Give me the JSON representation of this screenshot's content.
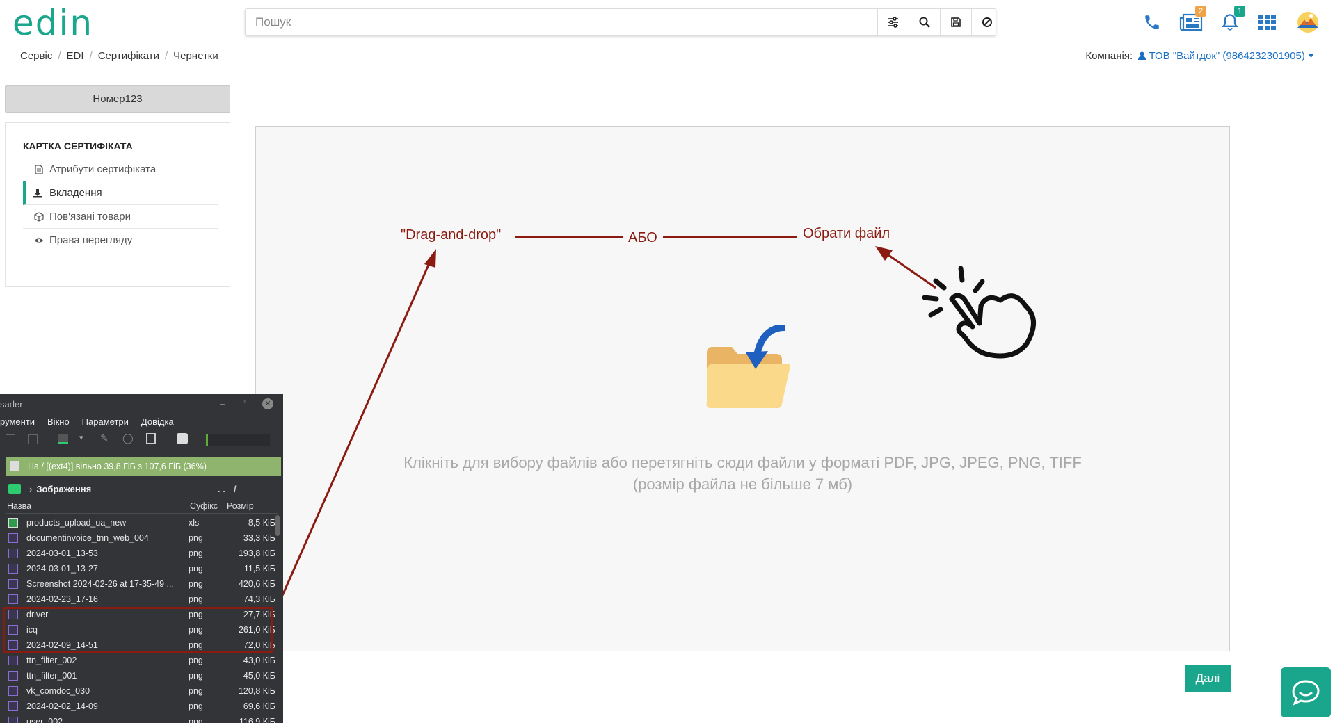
{
  "header": {
    "logo": "edin",
    "search_placeholder": "Пошук",
    "icons": [
      "filter-settings-icon",
      "search-icon",
      "save-icon",
      "cancel-icon",
      "phone-icon",
      "news-icon",
      "bell-icon",
      "apps-grid-icon",
      "user-avatar"
    ],
    "news_badge": "2",
    "bell_badge": "1"
  },
  "breadcrumbs": [
    "Сервіс",
    "EDI",
    "Сертифікати",
    "Чернетки"
  ],
  "company": {
    "label": "Компанія:",
    "value": "ТОВ \"Вайтдок\" (9864232301905)"
  },
  "sidebar": {
    "number_button": "Номер123",
    "card_title": "КАРТКА СЕРТИФІКАТА",
    "items": [
      {
        "label": "Атрибути сертифіката",
        "icon": "document-icon"
      },
      {
        "label": "Вкладення",
        "icon": "download-icon"
      },
      {
        "label": "Пов'язані товари",
        "icon": "box-icon"
      },
      {
        "label": "Права перегляду",
        "icon": "eye-icon"
      }
    ]
  },
  "dropzone": {
    "hint_line1": "Клікніть для вибору файлів або перетягніть сюди файли у форматі PDF, JPG, JPEG, PNG, TIFF",
    "hint_line2": "(розмір файла не більше 7 мб)",
    "annotation_drag": "\"Drag-and-drop\"",
    "annotation_or": "АБО",
    "annotation_choose": "Обрати файл"
  },
  "buttons": {
    "next": "Далі"
  },
  "file_manager": {
    "title": "sader",
    "menu": [
      "рументи",
      "Вікно",
      "Параметри",
      "Довідка"
    ],
    "status": "На / [(ext4)] вільно 39,8 ГіБ з 107,6 ГіБ (36%)",
    "path": "Зображення",
    "path_controls": [
      ". .",
      "/"
    ],
    "columns": {
      "name": "Назва",
      "suffix": "Суфікс",
      "size": "Розмір"
    },
    "files": [
      {
        "name": "products_upload_ua_new",
        "suffix": "xls",
        "size": "8,5 КіБ",
        "type": "spreadsheet"
      },
      {
        "name": "documentinvoice_tnn_web_004",
        "suffix": "png",
        "size": "33,3 КіБ",
        "type": "image"
      },
      {
        "name": "2024-03-01_13-53",
        "suffix": "png",
        "size": "193,8 КіБ",
        "type": "image"
      },
      {
        "name": "2024-03-01_13-27",
        "suffix": "png",
        "size": "11,5 КіБ",
        "type": "image"
      },
      {
        "name": "Screenshot 2024-02-26 at 17-35-49 ...",
        "suffix": "png",
        "size": "420,6 КіБ",
        "type": "image"
      },
      {
        "name": "2024-02-23_17-16",
        "suffix": "png",
        "size": "74,3 КіБ",
        "type": "image"
      },
      {
        "name": "driver",
        "suffix": "png",
        "size": "27,7 КіБ",
        "type": "image"
      },
      {
        "name": "icq",
        "suffix": "png",
        "size": "261,0 КіБ",
        "type": "image"
      },
      {
        "name": "2024-02-09_14-51",
        "suffix": "png",
        "size": "72,0 КіБ",
        "type": "image"
      },
      {
        "name": "ttn_filter_002",
        "suffix": "png",
        "size": "43,0 КіБ",
        "type": "image"
      },
      {
        "name": "ttn_filter_001",
        "suffix": "png",
        "size": "45,0 КіБ",
        "type": "image"
      },
      {
        "name": "vk_comdoc_030",
        "suffix": "png",
        "size": "120,8 КіБ",
        "type": "image"
      },
      {
        "name": "2024-02-02_14-09",
        "suffix": "png",
        "size": "69,6 КіБ",
        "type": "image"
      },
      {
        "name": "user_002",
        "suffix": "png",
        "size": "116,9 КіБ",
        "type": "image"
      }
    ]
  },
  "colors": {
    "brand": "#1aa68c",
    "annotation": "#8b1a10",
    "link": "#1a6fc4",
    "folder": "#f5c46d",
    "arrow_blue": "#1f5fbf"
  }
}
